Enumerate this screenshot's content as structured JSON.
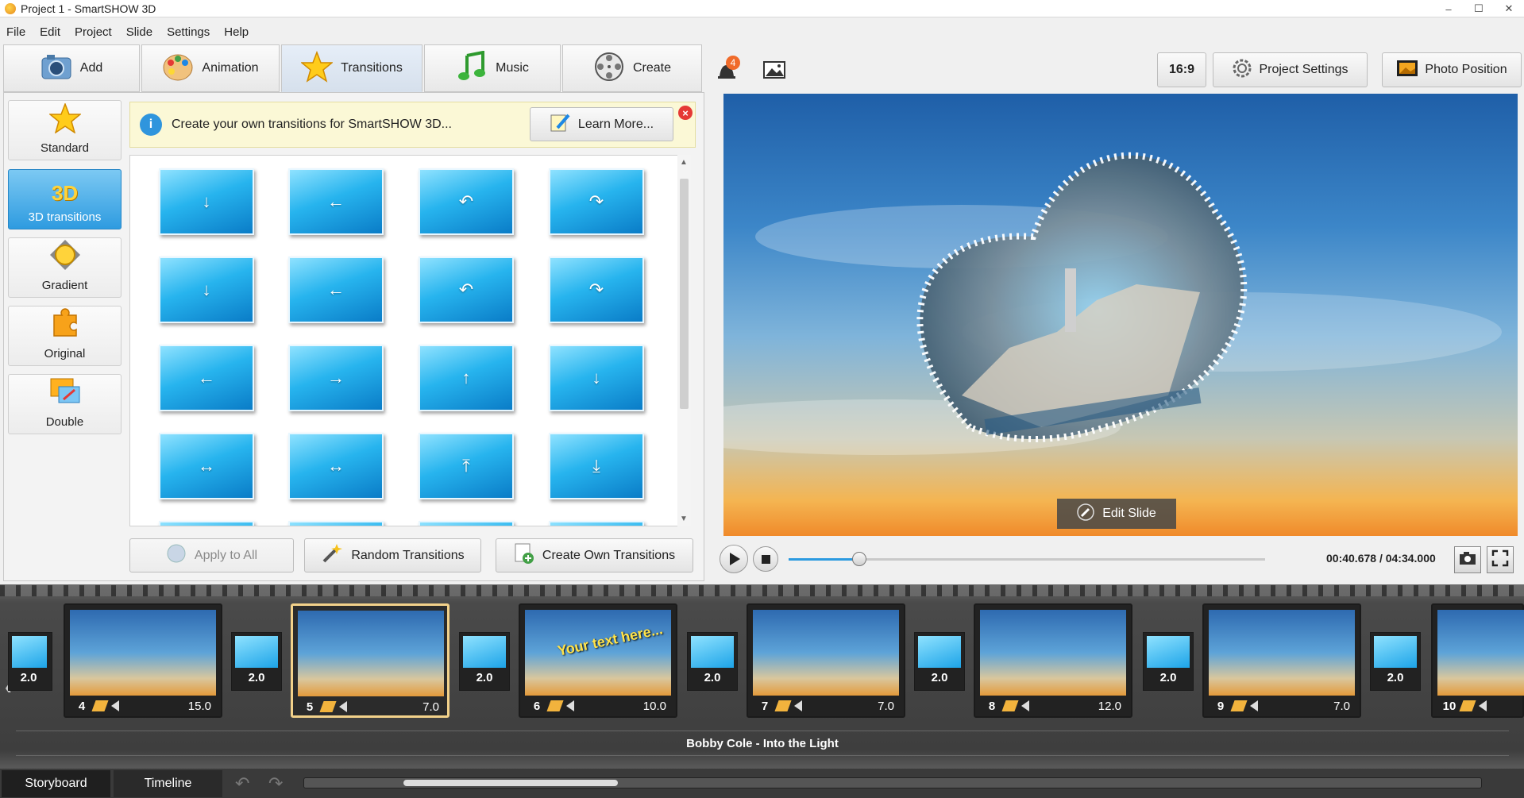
{
  "window": {
    "title": "Project 1 - SmartSHOW 3D"
  },
  "menu": [
    "File",
    "Edit",
    "Project",
    "Slide",
    "Settings",
    "Help"
  ],
  "main_tabs": [
    {
      "label": "Add",
      "icon": "camera-icon"
    },
    {
      "label": "Animation",
      "icon": "palette-icon"
    },
    {
      "label": "Transitions",
      "icon": "star-icon",
      "active": true
    },
    {
      "label": "Music",
      "icon": "music-note-icon"
    },
    {
      "label": "Create",
      "icon": "film-reel-icon"
    }
  ],
  "categories": [
    {
      "label": "Standard",
      "icon": "star-icon"
    },
    {
      "label": "3D transitions",
      "icon": "3d-icon",
      "badge": "3D",
      "active": true
    },
    {
      "label": "Gradient",
      "icon": "gradient-icon"
    },
    {
      "label": "Original",
      "icon": "puzzle-icon"
    },
    {
      "label": "Double",
      "icon": "double-icon"
    }
  ],
  "info_banner": {
    "text": "Create your own transitions for SmartSHOW 3D...",
    "learn_more": "Learn More..."
  },
  "transition_glyphs": [
    "↓",
    "←",
    "↶",
    "↷",
    "↓",
    "←",
    "↶",
    "↷",
    "←",
    "→",
    "↑",
    "↓",
    "↔",
    "↔",
    "⤒",
    "⤓"
  ],
  "bottom_buttons": {
    "apply_all": "Apply to All",
    "random": "Random Transitions",
    "create_own": "Create Own Transitions"
  },
  "notifications": {
    "count": "4"
  },
  "right_toolbar": {
    "aspect": "16:9",
    "project_settings": "Project Settings",
    "photo_position": "Photo Position"
  },
  "preview": {
    "edit_slide": "Edit Slide"
  },
  "player": {
    "timecode": "00:40.678 / 04:34.000",
    "progress": 0.149
  },
  "storyboard": {
    "first_transition": {
      "duration": "2.0"
    },
    "slides": [
      {
        "num": "4",
        "duration": "15.0"
      },
      {
        "num": "5",
        "duration": "7.0",
        "selected": true
      },
      {
        "num": "6",
        "duration": "10.0",
        "text": "Your text here..."
      },
      {
        "num": "7",
        "duration": "7.0"
      },
      {
        "num": "8",
        "duration": "12.0"
      },
      {
        "num": "9",
        "duration": "7.0"
      },
      {
        "num": "10",
        "duration": ""
      }
    ],
    "transitions": [
      "2.0",
      "2.0",
      "2.0",
      "2.0",
      "2.0",
      "2.0"
    ],
    "music": "Bobby Cole - Into the Light"
  },
  "bottom_tabs": {
    "storyboard": "Storyboard",
    "timeline": "Timeline"
  },
  "colors": {
    "accent": "#2e9be0",
    "selected_border": "#f2d18a"
  }
}
